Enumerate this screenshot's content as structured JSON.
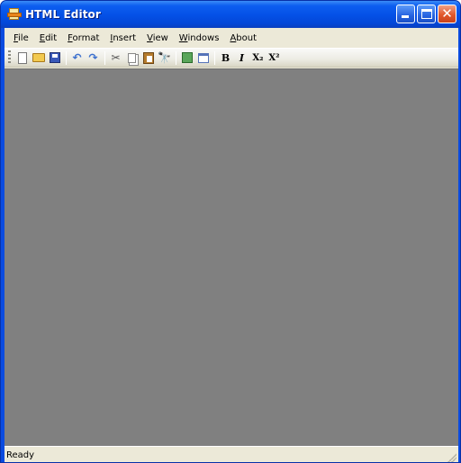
{
  "window": {
    "title": "HTML Editor",
    "minimize_icon": "minimize-icon",
    "maximize_icon": "maximize-icon",
    "close_icon": "close-icon"
  },
  "menu": [
    {
      "accel": "F",
      "rest": "ile"
    },
    {
      "accel": "E",
      "rest": "dit"
    },
    {
      "accel": "F",
      "rest": "ormat",
      "prefix": ""
    },
    {
      "accel": "I",
      "rest": "nsert"
    },
    {
      "accel": "V",
      "rest": "iew"
    },
    {
      "accel": "W",
      "rest": "indows"
    },
    {
      "accel": "A",
      "rest": "bout"
    }
  ],
  "toolbar": {
    "bold_label": "B",
    "italic_label": "I",
    "subscript_label": "X₂",
    "superscript_label": "X²",
    "icons": [
      "new-icon",
      "open-icon",
      "save-icon",
      "undo-icon",
      "redo-icon",
      "cut-icon",
      "copy-icon",
      "paste-icon",
      "find-icon",
      "export-icon",
      "window-icon"
    ]
  },
  "status": {
    "text": "Ready"
  },
  "colors": {
    "titlebar": "#0450e6",
    "editor_background": "#808080",
    "chrome": "#ece9d8"
  }
}
